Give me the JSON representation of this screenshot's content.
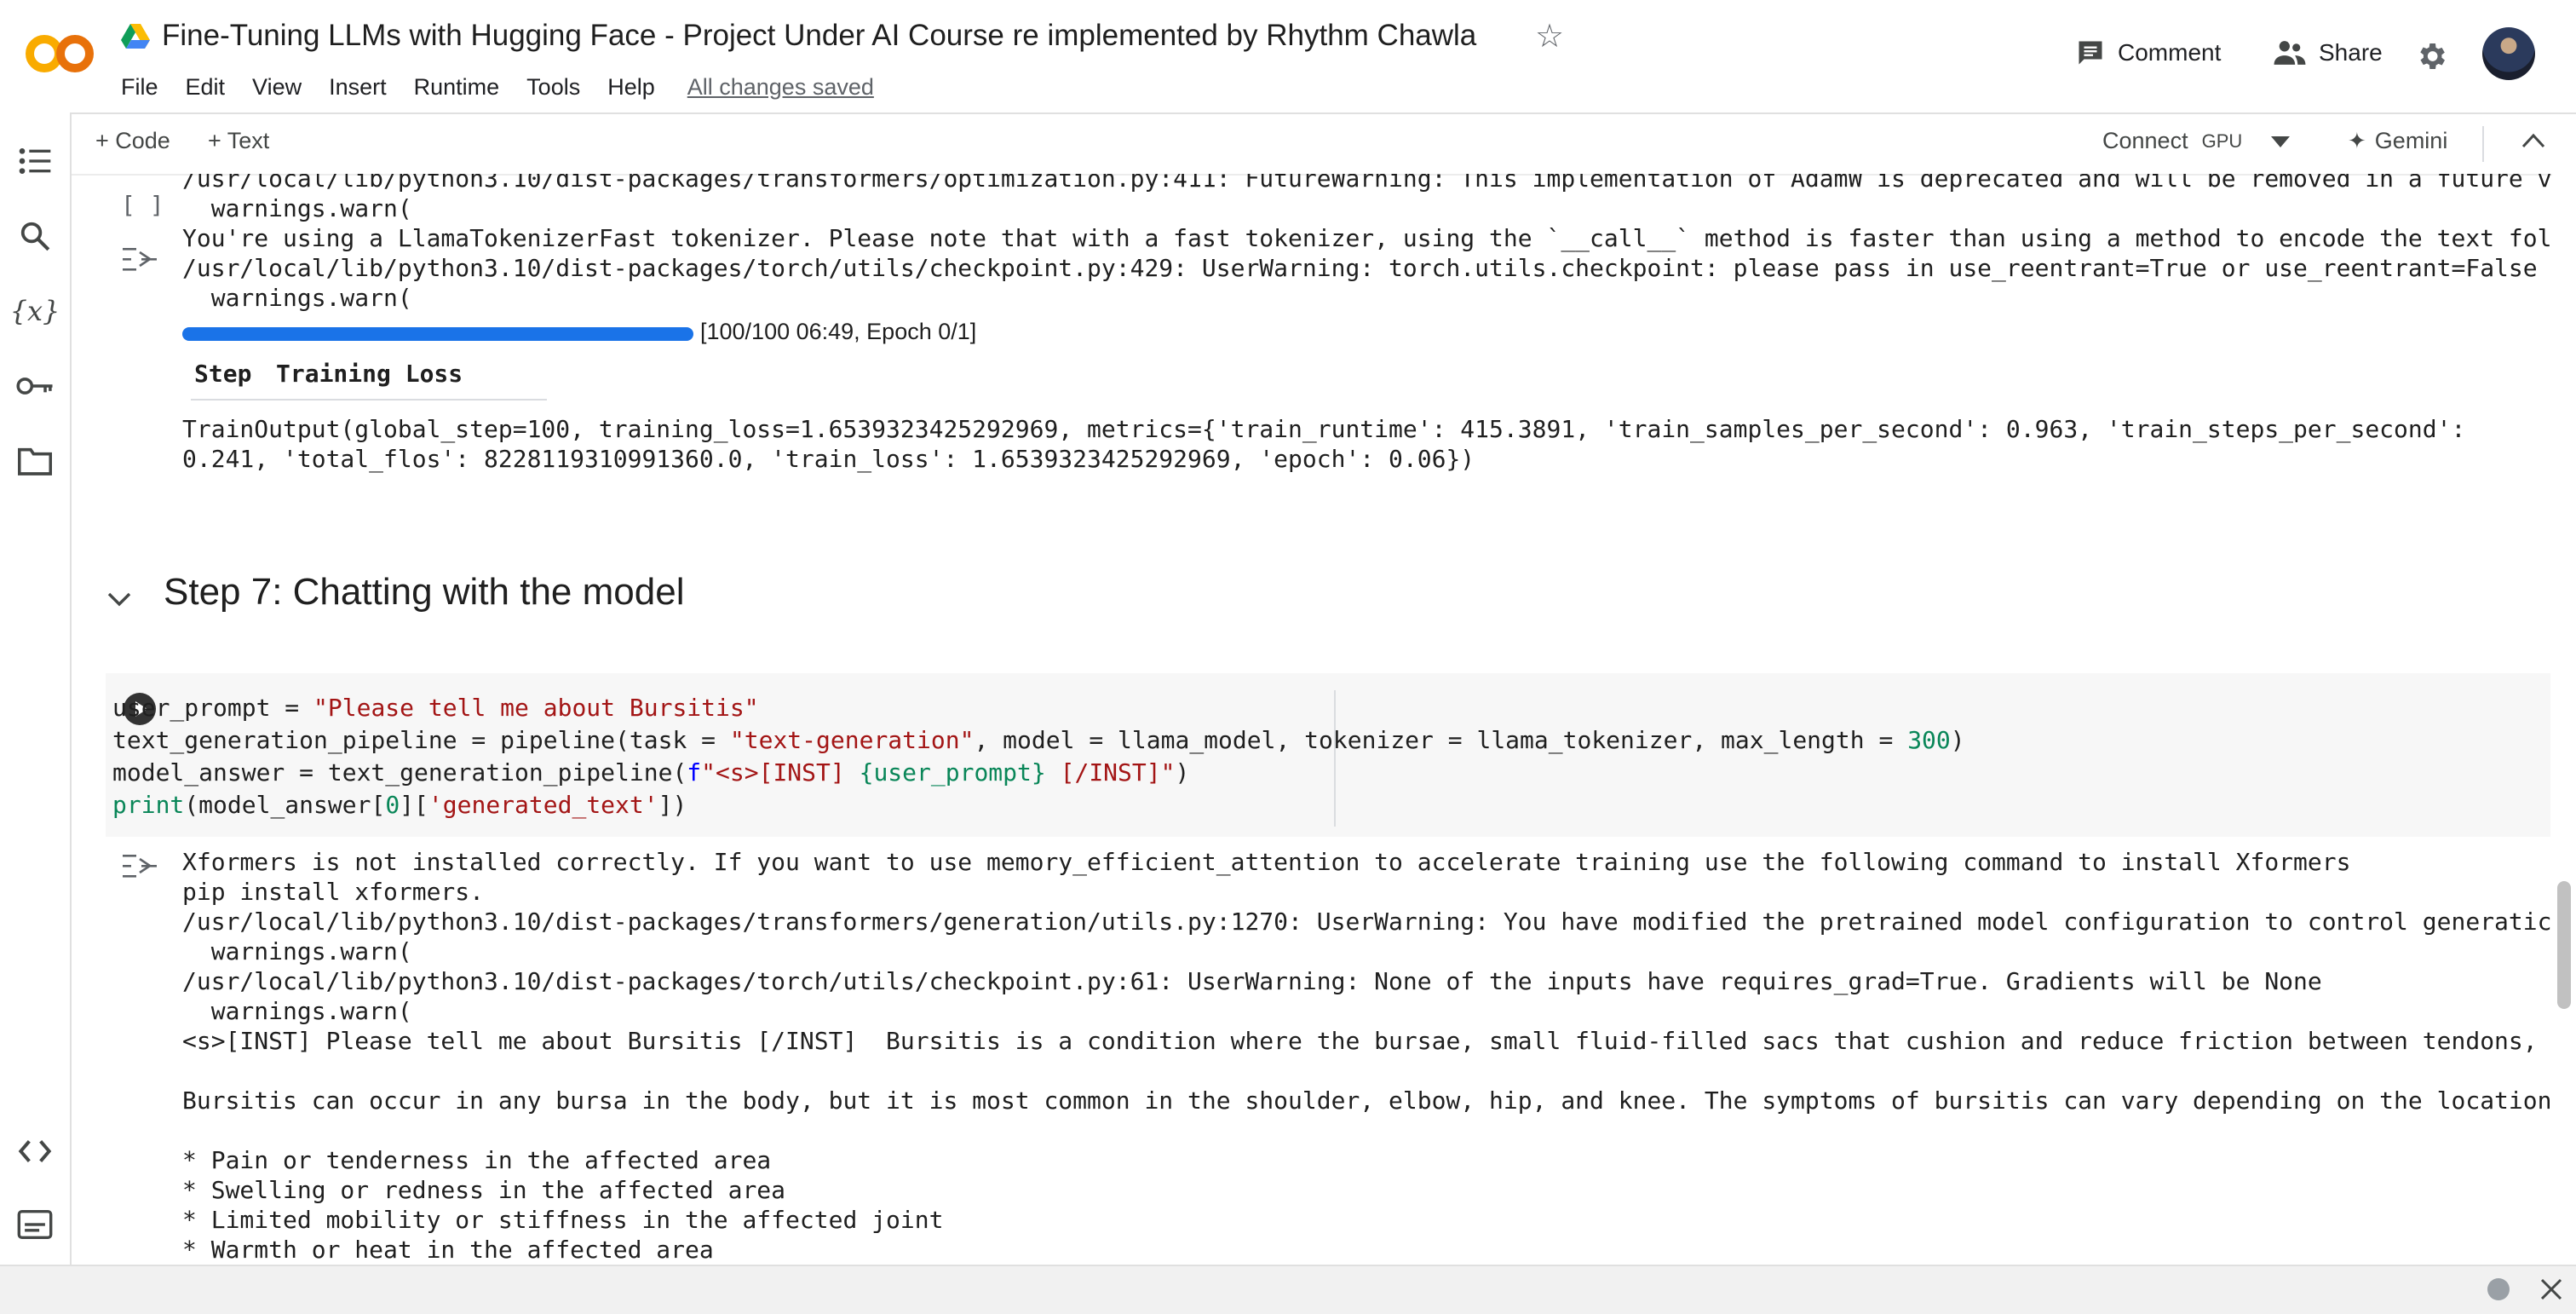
{
  "colors": {
    "accent": "#1a73e8",
    "colab_orange": "#f9ab00",
    "text": "#1f1f1f",
    "string": "#a31515",
    "number": "#098658"
  },
  "header": {
    "title": "Fine-Tuning LLMs with Hugging Face - Project Under AI Course re implemented by Rhythm Chawla",
    "menu": [
      "File",
      "Edit",
      "View",
      "Insert",
      "Runtime",
      "Tools",
      "Help"
    ],
    "save_status": "All changes saved",
    "comment_label": "Comment",
    "share_label": "Share"
  },
  "toolbar": {
    "add_code": "+ Code",
    "add_text": "+ Text",
    "connect": "Connect",
    "runtime_type": "GPU",
    "gemini": "Gemini"
  },
  "sidebar_icons": [
    "table-of-contents-icon",
    "search-icon",
    "variables-icon",
    "secrets-key-icon",
    "files-folder-icon",
    "code-snippets-icon",
    "terminal-icon"
  ],
  "cell1": {
    "exec_count": "[ ]",
    "output_lines": [
      "/usr/local/lib/python3.10/dist-packages/transformers/optimization.py:411: FutureWarning: This implementation of AdamW is deprecated and will be removed in a future v",
      "  warnings.warn(",
      "You're using a LlamaTokenizerFast tokenizer. Please note that with a fast tokenizer, using the `__call__` method is faster than using a method to encode the text fol",
      "/usr/local/lib/python3.10/dist-packages/torch/utils/checkpoint.py:429: UserWarning: torch.utils.checkpoint: please pass in use_reentrant=True or use_reentrant=False",
      "  warnings.warn("
    ],
    "progress": {
      "fraction": 1.0,
      "label": "[100/100 06:49, Epoch 0/1]"
    },
    "table_headers": [
      "Step",
      "Training Loss"
    ],
    "train_output": [
      "TrainOutput(global_step=100, training_loss=1.6539323425292969, metrics={'train_runtime': 415.3891, 'train_samples_per_second': 0.963, 'train_steps_per_second':",
      "0.241, 'total_flos': 8228119310991360.0, 'train_loss': 1.6539323425292969, 'epoch': 0.06})"
    ]
  },
  "section": {
    "heading": "Step 7: Chatting with the model"
  },
  "code": {
    "line1": {
      "a": "user_prompt = ",
      "b": "\"Please tell me about Bursitis\""
    },
    "line2": {
      "a": "text_generation_pipeline = pipeline(task = ",
      "b": "\"text-generation\"",
      "c": ", model = llama_model, tokenizer = llama_tokenizer, max_length = ",
      "d": "300",
      "e": ")"
    },
    "line3": {
      "a": "model_answer = text_generation_pipeline(",
      "b": "f",
      "c": "\"<s>[INST] ",
      "d": "{user_prompt}",
      "e": " [/INST]\"",
      "f": ")"
    },
    "line4": {
      "a": "print",
      "b": "(model_answer[",
      "c": "0",
      "d": "][",
      "e": "'generated_text'",
      "f": "])"
    }
  },
  "cell2_output": [
    "Xformers is not installed correctly. If you want to use memory_efficient_attention to accelerate training use the following command to install Xformers",
    "pip install xformers.",
    "/usr/local/lib/python3.10/dist-packages/transformers/generation/utils.py:1270: UserWarning: You have modified the pretrained model configuration to control generatic",
    "  warnings.warn(",
    "/usr/local/lib/python3.10/dist-packages/torch/utils/checkpoint.py:61: UserWarning: None of the inputs have requires_grad=True. Gradients will be None",
    "  warnings.warn(",
    "<s>[INST] Please tell me about Bursitis [/INST]  Bursitis is a condition where the bursae, small fluid-filled sacs that cushion and reduce friction between tendons,",
    "",
    "Bursitis can occur in any bursa in the body, but it is most common in the shoulder, elbow, hip, and knee. The symptoms of bursitis can vary depending on the location",
    "",
    "* Pain or tenderness in the affected area",
    "* Swelling or redness in the affected area",
    "* Limited mobility or stiffness in the affected joint",
    "* Warmth or heat in the affected area"
  ]
}
